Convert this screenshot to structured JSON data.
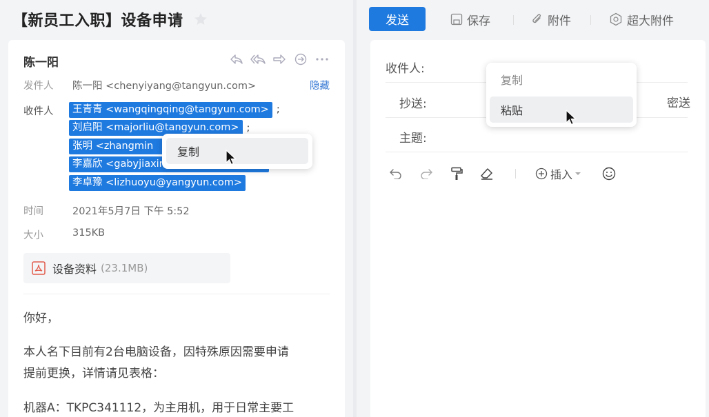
{
  "mail": {
    "title": "【新员工入职】设备申请",
    "sender_name": "陈一阳",
    "from_label": "发件人",
    "from_value": "陈一阳 <chenyiyang@tangyun.com>",
    "hide_label": "隐藏",
    "to_label": "收件人",
    "recipients": [
      "王青青 <wangqingqing@tangyun.com>",
      "刘启阳 <majorliu@tangyun.com>",
      "张明 <zhangmin",
      "李嘉欣 <gabyjiaxin",
      "李卓豫 <lizhuoyu@yangyun.com>"
    ],
    "separator": ";",
    "time_label": "时间",
    "time_value": "2021年5月7日 下午 5:52",
    "size_label": "大小",
    "size_value": "315KB",
    "attachment": {
      "name": "设备资料",
      "size": "(23.1MB)"
    },
    "body": {
      "greeting": "你好，",
      "paragraph1_line1": "本人名下目前有2台电脑设备，因特殊原因需要申请",
      "paragraph1_line2": "提前更换，详情请见表格：",
      "paragraph2_line1": "机器A：TKPC341112，为主用机，用于日常主要工"
    },
    "context_menu": {
      "copy": "复制"
    }
  },
  "compose": {
    "toolbar": {
      "send": "发送",
      "save": "保存",
      "attach": "附件",
      "large_attach": "超大附件"
    },
    "to_label": "收件人:",
    "cc_label": "抄送:",
    "bcc_label": "密送",
    "subject_label": "主题:",
    "insert_label": "插入",
    "context_menu": {
      "copy": "复制",
      "paste": "粘贴"
    }
  },
  "colors": {
    "accent": "#1f7ae0",
    "link": "#3a7bd5"
  }
}
